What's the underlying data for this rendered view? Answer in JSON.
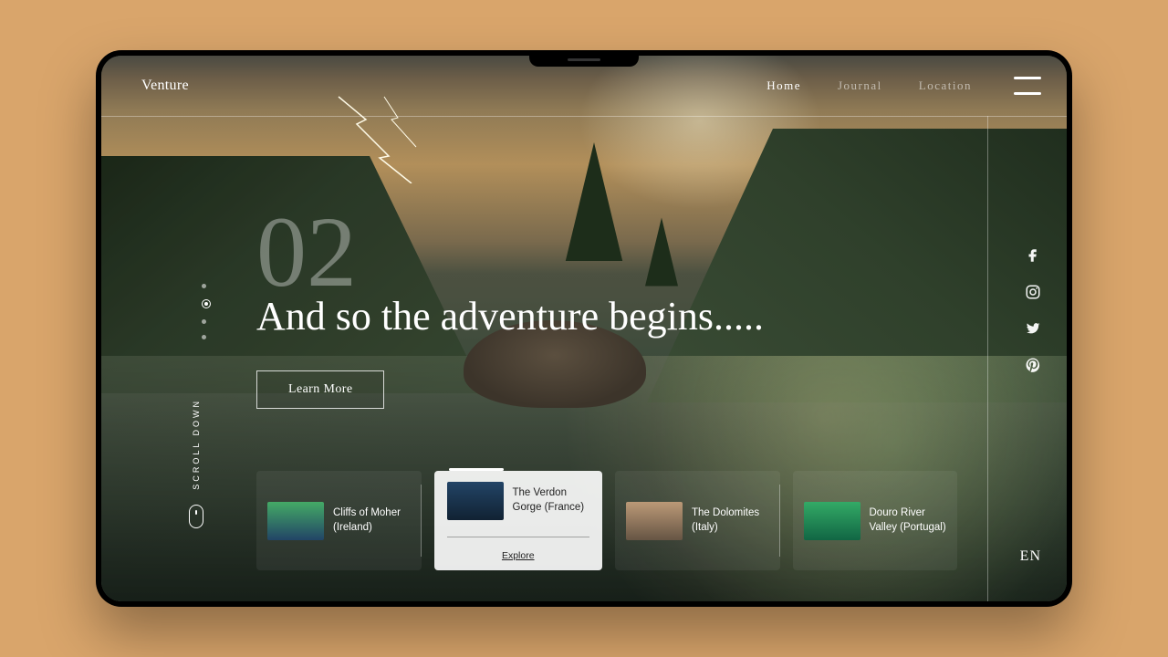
{
  "brand": "Venture",
  "nav": {
    "home": "Home",
    "journal": "Journal",
    "location": "Location"
  },
  "hero": {
    "index": "02",
    "headline": "And so the adventure begins.....",
    "cta": "Learn More"
  },
  "scroll_label": "SCROLL DOWN",
  "language": "EN",
  "pager": {
    "count": 4,
    "active": 1
  },
  "cards": [
    {
      "title": "Cliffs of Moher (Ireland)"
    },
    {
      "title": "The Verdon Gorge (France)",
      "explore": "Explore",
      "active": true
    },
    {
      "title": "The Dolomites (Italy)"
    },
    {
      "title": "Douro River Valley (Portugal)"
    }
  ],
  "socials": [
    "facebook",
    "instagram",
    "twitter",
    "pinterest"
  ]
}
